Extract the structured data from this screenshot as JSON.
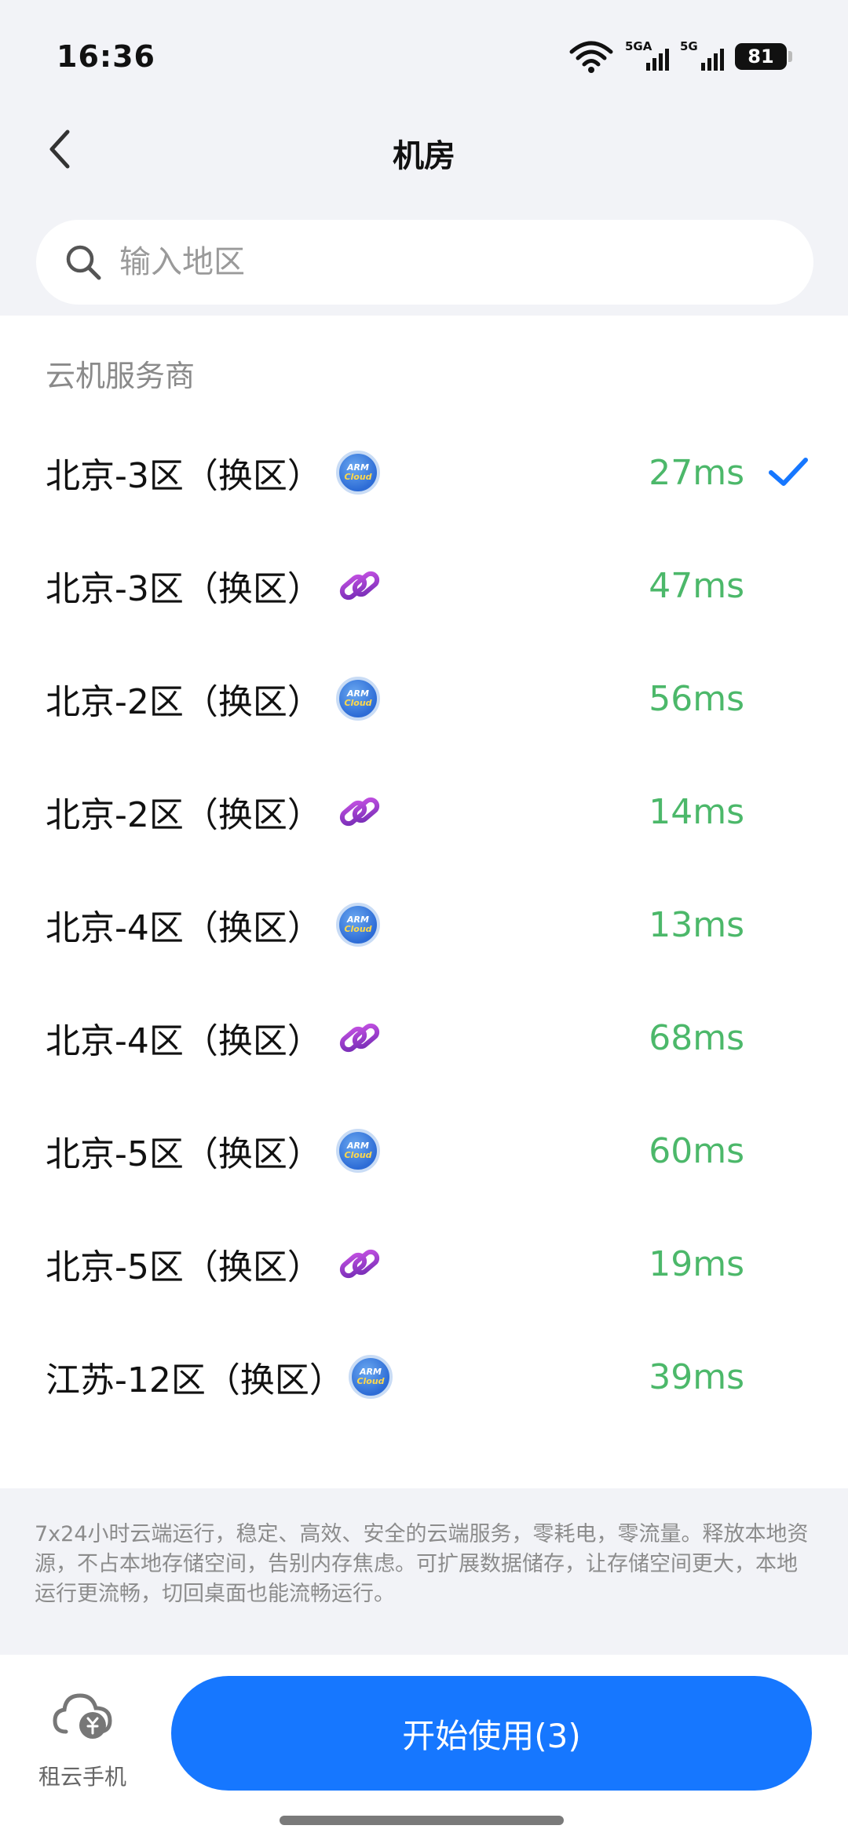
{
  "status_bar": {
    "time": "16:36",
    "signal_1_label": "5GA",
    "signal_2_label": "5G",
    "battery": "81",
    "icons": [
      "wifi-icon",
      "signal-icon",
      "signal-icon",
      "battery-icon"
    ]
  },
  "header": {
    "title": "机房",
    "back_icon": "chevron-left-icon"
  },
  "search": {
    "placeholder": "输入地区",
    "value": "",
    "icon": "search-icon"
  },
  "section": {
    "label": "云机服务商"
  },
  "rooms": [
    {
      "name": "北京-3区（换区）",
      "provider": "armcloud",
      "latency": "27ms",
      "selected": true
    },
    {
      "name": "北京-3区（换区）",
      "provider": "link",
      "latency": "47ms",
      "selected": false
    },
    {
      "name": "北京-2区（换区）",
      "provider": "armcloud",
      "latency": "56ms",
      "selected": false
    },
    {
      "name": "北京-2区（换区）",
      "provider": "link",
      "latency": "14ms",
      "selected": false
    },
    {
      "name": "北京-4区（换区）",
      "provider": "armcloud",
      "latency": "13ms",
      "selected": false
    },
    {
      "name": "北京-4区（换区）",
      "provider": "link",
      "latency": "68ms",
      "selected": false
    },
    {
      "name": "北京-5区（换区）",
      "provider": "armcloud",
      "latency": "60ms",
      "selected": false
    },
    {
      "name": "北京-5区（换区）",
      "provider": "link",
      "latency": "19ms",
      "selected": false
    },
    {
      "name": "江苏-12区（换区）",
      "provider": "armcloud",
      "latency": "39ms",
      "selected": false
    }
  ],
  "provider_logo_text": {
    "line1": "ARM",
    "line2": "Cloud"
  },
  "description": "7x24小时云端运行，稳定、高效、安全的云端服务，零耗电，零流量。释放本地资源，不占本地存储空间，告别内存焦虑。可扩展数据储存，让存储空间更大，本地运行更流畅，切回桌面也能流畅运行。",
  "bottom": {
    "rent_label": "租云手机",
    "rent_icon": "cloud-yen-icon",
    "start_label": "开始使用(3)"
  },
  "colors": {
    "accent": "#1677ff",
    "latency": "#4cb86a",
    "background_gray": "#f2f3f7"
  }
}
